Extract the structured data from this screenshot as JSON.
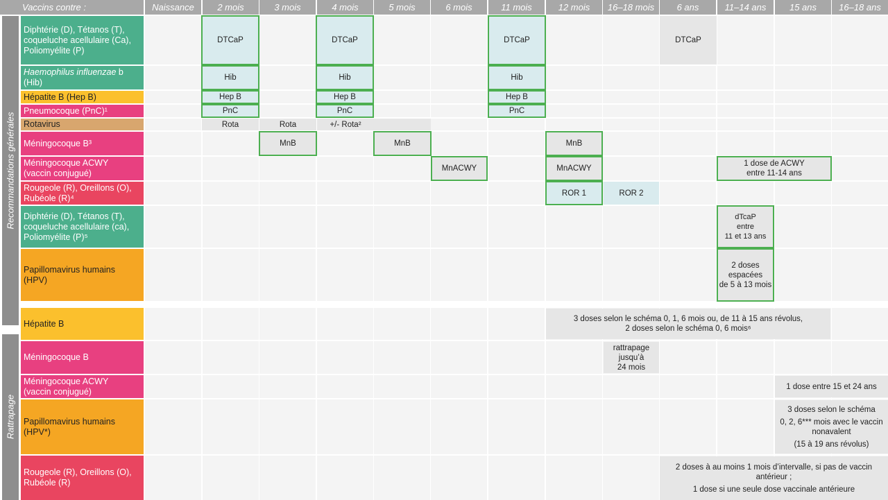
{
  "header": {
    "col0": "Vaccins contre :",
    "cols": [
      "Naissance",
      "2 mois",
      "3 mois",
      "4 mois",
      "5 mois",
      "6 mois",
      "11 mois",
      "12 mois",
      "16–18 mois",
      "6 ans",
      "11–14 ans",
      "15 ans",
      "16–18 ans"
    ]
  },
  "sections": {
    "general": "Recommandations générales",
    "catchup": "Rattrapage"
  },
  "rows": {
    "dtcap": [
      "Diphtérie (D), Tétanos (T),",
      "coqueluche acellulaire (Ca),",
      "Poliomyélite (P)"
    ],
    "hib": [
      "Haemophilus influenzae",
      "b",
      "(Hib)"
    ],
    "hepb": "Hépatite B (Hep B)",
    "pnc": "Pneumocoque (PnC)¹",
    "rota": "Rotavirus",
    "mnb": "Méningocoque B³",
    "acwy": [
      "Méningocoque ACWY",
      "(vaccin conjugué)"
    ],
    "ror": [
      "Rougeole (R), Oreillons (O),",
      "Rubéole (R)⁴"
    ],
    "dtcap2": [
      "Diphtérie (D), Tétanos (T),",
      "coqueluche acellulaire (ca),",
      "Poliomyélite (P)⁵"
    ],
    "hpv": [
      "Papillomavirus humains",
      "(HPV)"
    ],
    "c_hepb": "Hépatite B",
    "c_mnb": "Méningocoque B",
    "c_acwy": [
      "Méningocoque ACWY",
      "(vaccin conjugué)"
    ],
    "c_hpv": [
      "Papillomavirus humains",
      "(HPV*)"
    ],
    "c_ror": [
      "Rougeole (R), Oreillons (O),",
      "Rubéole (R)"
    ]
  },
  "cells": {
    "dtcap": "DTCaP",
    "hib": "Hib",
    "hepb": "Hep B",
    "pnc": "PnC",
    "rota": "Rota",
    "rota_opt": "+/- Rota²",
    "mnb": "MnB",
    "mnacwy": "MnACWY",
    "acwy_teen": [
      "1 dose de ACWY",
      "entre 11-14 ans"
    ],
    "ror1": "ROR 1",
    "ror2": "ROR 2",
    "dtcap_teen": [
      "dTcaP",
      "entre",
      "11 et 13 ans"
    ],
    "hpv_teen": [
      "2 doses",
      "espacées",
      "de 5 à 13 mois"
    ],
    "c_hepb": [
      "3 doses selon le schéma 0, 1, 6 mois ou, de 11 à 15 ans révolus,",
      "2 doses selon le schéma 0, 6 mois⁶"
    ],
    "c_mnb": [
      "rattrapage",
      "jusqu’à",
      "24 mois"
    ],
    "c_acwy": "1 dose entre 15 et 24 ans",
    "c_hpv": [
      "3 doses selon le schéma",
      "0, 2, 6*** mois avec le vaccin",
      "nonavalent",
      "(15 à 19 ans révolus)"
    ],
    "c_ror": [
      "2 doses à au moins 1 mois d’intervalle, si pas de vaccin",
      "antérieur ;",
      "1 dose si une seule dose vaccinale antérieure"
    ]
  },
  "colors": {
    "green": "#4caf8c",
    "yellow": "#fbc02d",
    "pink": "#e84080",
    "tan": "#d8a66e",
    "red": "#e94560",
    "orange": "#f5a623",
    "header": "#a8a8a8",
    "cell": "#f4f4f4",
    "box_border": "#4caf50",
    "box_fill": "#d9ebee"
  }
}
